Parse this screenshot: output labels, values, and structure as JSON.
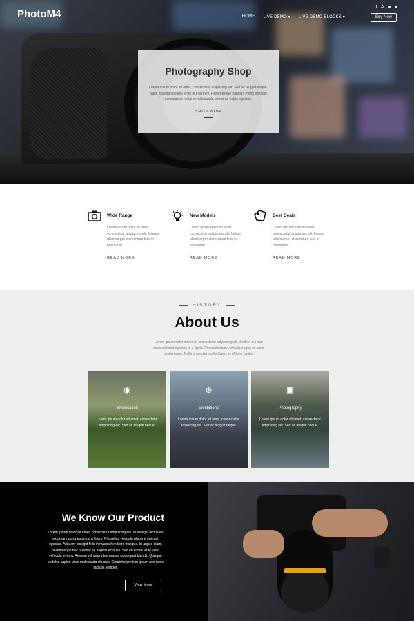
{
  "nav": {
    "logo": "PhotoM4",
    "menu": [
      "HOME",
      "LIVE DEMO ▾",
      "LIVE DEMO BLOCKS ▾"
    ],
    "buy_label": "Buy Now",
    "social_icons": [
      "facebook-icon",
      "vk-icon",
      "instagram-icon",
      "twitter-icon"
    ]
  },
  "hero": {
    "title": "Photography Shop",
    "text": "Lorem ipsum dolor sit amet, consectetur adipiscing elit. Sed ac feugiat neque. Nulla gravida sodales enim et interdum. Pellentesque habitant morbi tristique senectus et netus et malesuada fames ac turpis egestas.",
    "cta": "SHOP NOW"
  },
  "features": [
    {
      "icon": "camera-icon",
      "title": "Wide Range",
      "text": "Lorem ipsum dolor sit amet, consectetur adipiscing elit. Integer ullamcorper elementum felis in bibendum.",
      "more": "READ MORE"
    },
    {
      "icon": "lightbulb-icon",
      "title": "New Models",
      "text": "Lorem ipsum dolor sit amet, consectetur adipiscing elit. Integer ullamcorper elementum felis in bibendum.",
      "more": "READ MORE"
    },
    {
      "icon": "tag-icon",
      "title": "Best Deals",
      "text": "Lorem ipsum dolor sit amet, consectetur adipiscing elit. Integer ullamcorper elementum felis in bibendum.",
      "more": "READ MORE"
    }
  ],
  "about": {
    "eyebrow": "HISTORY",
    "title": "About Us",
    "intro": "Lorem ipsum dolor sit amet, consectetur adipiscing elit. Sed eu dui non diam eleifend egestas id a ligula. Proin interdum vehicula neque sit amet scelerisque. Nulla imperdiet mollis libero, in efficitur ligula.",
    "tiles": [
      {
        "icon": "eye-icon",
        "title": "Showcases",
        "text": "Lorem ipsum dolor sit amet, consectetur adipiscing elit. Sed ac feugiat neque."
      },
      {
        "icon": "globe-icon",
        "title": "Exhibitions",
        "text": "Lorem ipsum dolor sit amet, consectetur adipiscing elit. Sed ac feugiat neque."
      },
      {
        "icon": "camera-icon",
        "title": "Photography",
        "text": "Lorem ipsum dolor sit amet, consectetur adipiscing elit. Sed ac feugiat neque."
      }
    ]
  },
  "product": {
    "title": "We Know Our Product",
    "text": "Lorem ipsum dolor sit amet, consectetur adipiscing elit. Nulla eget lectus eu ex ornare porta euismod a libero. Phasellus vehicula placerat enim et egestas. Aliquam suscipit felis in massa hendrerit tristique. In augue diam, pellentesque nec pulvinar in, sagittis ac nulla. Sed eu lectus vitae justo vehicula viverra. Aenean vel urna vitae massa consequat blandit. Quisque sodales sapien vitae malesuada ultricies. Curabitur pretium ipsum non nunc facilisis semper.",
    "button": "View More"
  }
}
